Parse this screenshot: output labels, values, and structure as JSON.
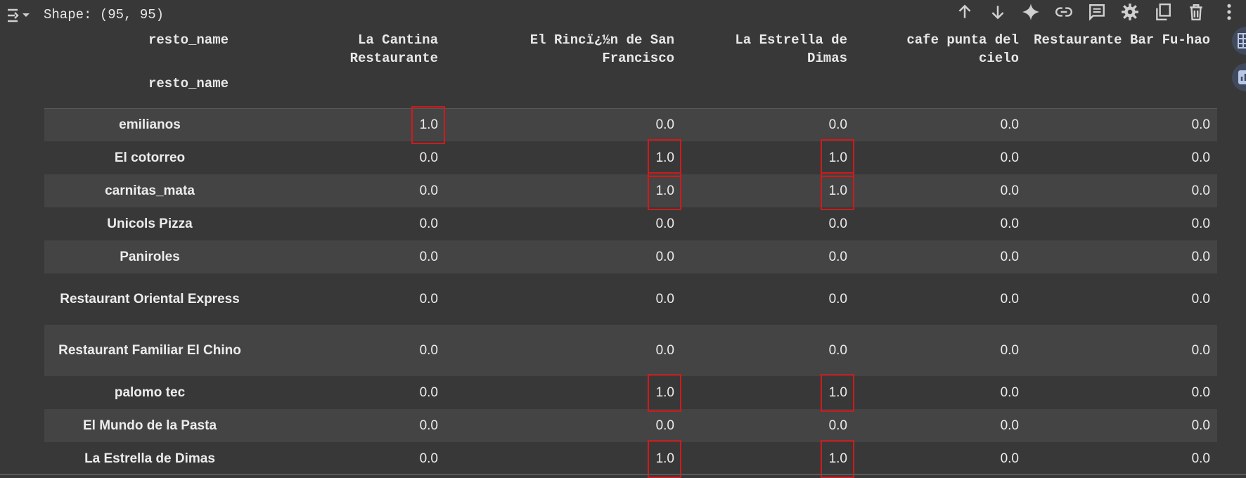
{
  "output": {
    "shape_text": "Shape: (95, 95)"
  },
  "toolbar": {
    "icons": [
      "arrow-up-icon",
      "arrow-down-icon",
      "sparkle-icon",
      "link-icon",
      "comment-icon",
      "gear-icon",
      "copy-icon",
      "trash-icon",
      "more-icon"
    ]
  },
  "table": {
    "index_name_top": "resto_name",
    "index_name_bottom": "resto_name",
    "columns": [
      "La Cantina Restaurante",
      "El Rincï¿½n de San Francisco",
      "La Estrella de Dimas",
      "cafe punta del cielo",
      "Restaurante Bar Fu-hao"
    ],
    "rows": [
      {
        "name": "emilianos",
        "values": [
          "1.0",
          "0.0",
          "0.0",
          "0.0",
          "0.0"
        ]
      },
      {
        "name": "El cotorreo",
        "values": [
          "0.0",
          "1.0",
          "1.0",
          "0.0",
          "0.0"
        ]
      },
      {
        "name": "carnitas_mata",
        "values": [
          "0.0",
          "1.0",
          "1.0",
          "0.0",
          "0.0"
        ]
      },
      {
        "name": "Unicols Pizza",
        "values": [
          "0.0",
          "0.0",
          "0.0",
          "0.0",
          "0.0"
        ]
      },
      {
        "name": "Paniroles",
        "values": [
          "0.0",
          "0.0",
          "0.0",
          "0.0",
          "0.0"
        ]
      },
      {
        "name": "Restaurant Oriental Express",
        "values": [
          "0.0",
          "0.0",
          "0.0",
          "0.0",
          "0.0"
        ]
      },
      {
        "name": "Restaurant Familiar El Chino",
        "values": [
          "0.0",
          "0.0",
          "0.0",
          "0.0",
          "0.0"
        ]
      },
      {
        "name": "palomo tec",
        "values": [
          "0.0",
          "1.0",
          "1.0",
          "0.0",
          "0.0"
        ]
      },
      {
        "name": "El Mundo de la Pasta",
        "values": [
          "0.0",
          "0.0",
          "0.0",
          "0.0",
          "0.0"
        ]
      },
      {
        "name": "La Estrella de Dimas",
        "values": [
          "0.0",
          "1.0",
          "1.0",
          "0.0",
          "0.0"
        ]
      }
    ]
  },
  "colors": {
    "background": "#383838",
    "stripe": "#444444",
    "highlight_box": "#d11a1a"
  }
}
